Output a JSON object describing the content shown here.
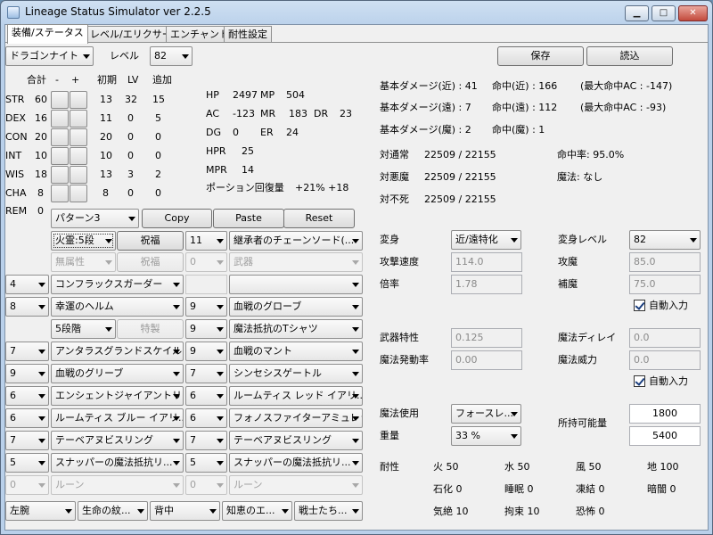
{
  "window": {
    "title": "Lineage Status Simulator ver 2.2.5",
    "min": "▁",
    "max": "□",
    "close": "✕"
  },
  "tabs": [
    "装備/ステータス",
    "レベル/エリクサー",
    "エンチャント",
    "耐性設定"
  ],
  "top": {
    "class": "ドラゴンナイト",
    "level_label": "レベル",
    "level": "82",
    "save": "保存",
    "load": "読込"
  },
  "stats_header": {
    "total": "合計",
    "minus": "-",
    "plus": "+",
    "initial": "初期",
    "lv": "LV",
    "add": "追加"
  },
  "stats": [
    {
      "name": "STR",
      "total": "60",
      "initial": "13",
      "lv": "32",
      "add": "15"
    },
    {
      "name": "DEX",
      "total": "16",
      "initial": "11",
      "lv": "0",
      "add": "5"
    },
    {
      "name": "CON",
      "total": "20",
      "initial": "20",
      "lv": "0",
      "add": "0"
    },
    {
      "name": "INT",
      "total": "10",
      "initial": "10",
      "lv": "0",
      "add": "0"
    },
    {
      "name": "WIS",
      "total": "18",
      "initial": "13",
      "lv": "3",
      "add": "2"
    },
    {
      "name": "CHA",
      "total": "8",
      "initial": "8",
      "lv": "0",
      "add": "0"
    }
  ],
  "rem": {
    "label": "REM",
    "value": "0"
  },
  "combat": {
    "hp_l": "HP",
    "hp": "2497",
    "mp_l": "MP",
    "mp": "504",
    "ac_l": "AC",
    "ac": "-123",
    "mr_l": "MR",
    "mr": "183",
    "dr_l": "DR",
    "dr": "23",
    "dg_l": "DG",
    "dg": "0",
    "er_l": "ER",
    "er": "24",
    "hpr_l": "HPR",
    "hpr": "25",
    "mpr_l": "MPR",
    "mpr": "14",
    "potion_l": "ポーション回復量",
    "potion": "+21% +18"
  },
  "damage": {
    "r1": "基本ダメージ(近) : 41",
    "r1b": "命中(近) : 166",
    "r1c": "(最大命中AC : -147)",
    "r2": "基本ダメージ(遠) : 7",
    "r2b": "命中(遠) : 112",
    "r2c": "(最大命中AC : -93)",
    "r3": "基本ダメージ(魔) : 2",
    "r3b": "命中(魔) : 1"
  },
  "versus": {
    "normal_l": "対通常",
    "normal": "22509 / 22155",
    "evil_l": "対悪魔",
    "evil": "22509 / 22155",
    "undead_l": "対不死",
    "undead": "22509 / 22155",
    "hitrate": "命中率: 95.0%",
    "magic": "魔法: なし"
  },
  "pattern": {
    "value": "パターン3",
    "copy": "Copy",
    "paste": "Paste",
    "reset": "Reset"
  },
  "equip": {
    "enchant1": "火霊:5段",
    "bless1": "祝福",
    "lv1": "11",
    "weapon1": "継承者のチェーンソード(...",
    "enchant2": "無属性",
    "bless2": "祝福",
    "lv2": "0",
    "weapon2": "武器",
    "r3_lv": "4",
    "r3_item": "コンフラックスガーダー",
    "r3b_item": "",
    "r4_lv": "8",
    "r4_item": "幸運のヘルム",
    "r4b_lv": "9",
    "r4b_item": "血戦のグローブ",
    "r5_stage": "5段階",
    "r5_special": "特製",
    "r5b_lv": "9",
    "r5b_item": "魔法抵抗のTシャツ",
    "r6_lv": "7",
    "r6_item": "アンタラスグランドスケイル...",
    "r6b_lv": "9",
    "r6b_item": "血戦のマント",
    "r7_lv": "9",
    "r7_item": "血戦のグリーブ",
    "r7b_lv": "7",
    "r7b_item": "シンセシスゲートル",
    "r8_lv": "6",
    "r8_item": "エンシェントジャイアントリン...",
    "r8b_lv": "6",
    "r8b_item": "ルームティス レッド イアリ...",
    "r9_lv": "6",
    "r9_item": "ルームティス ブルー イアリ...",
    "r9b_lv": "6",
    "r9b_item": "フォノスファイターアミュレット",
    "r10_lv": "7",
    "r10_item": "テーベアヌビスリング",
    "r10b_lv": "7",
    "r10b_item": "テーベアヌビスリング",
    "r11_lv": "5",
    "r11_item": "スナッパーの魔法抵抗リ...",
    "r11b_lv": "5",
    "r11b_item": "スナッパーの魔法抵抗リ...",
    "r12_lv": "0",
    "r12_item": "ルーン",
    "r12b_lv": "0",
    "r12b_item": "ルーン"
  },
  "bottom": {
    "b1": "左腕",
    "b2": "生命の紋...",
    "b3": "背中",
    "b4": "知恵のエ...",
    "b5": "戦士たち..."
  },
  "transform": {
    "label": "変身",
    "value": "近/遠特化",
    "level_label": "変身レベル",
    "level": "82",
    "speed_l": "攻撃速度",
    "speed": "114.0",
    "atk_l": "攻魔",
    "atk": "85.0",
    "rate_l": "倍率",
    "rate": "1.78",
    "supp_l": "補魔",
    "supp": "75.0",
    "auto": "自動入力"
  },
  "weapon_stats": {
    "trait_l": "武器特性",
    "trait": "0.125",
    "delay_l": "魔法ディレイ",
    "delay": "0.0",
    "fire_l": "魔法発動率",
    "fire": "0.00",
    "power_l": "魔法威力",
    "power": "0.0",
    "auto": "自動入力"
  },
  "magic": {
    "use_l": "魔法使用",
    "use": "フォースレ...",
    "weight_l": "重量",
    "weight": "33 %",
    "cap_l": "所持可能量",
    "cap1": "1800",
    "cap2": "5400"
  },
  "resist": {
    "label": "耐性",
    "fire": "火 50",
    "water": "水 50",
    "wind": "風 50",
    "earth": "地 100",
    "stone": "石化 0",
    "sleep": "睡眠 0",
    "freeze": "凍結 0",
    "dark": "暗闇 0",
    "stun": "気絶 10",
    "bind": "拘束 10",
    "fear": "恐怖 0"
  }
}
